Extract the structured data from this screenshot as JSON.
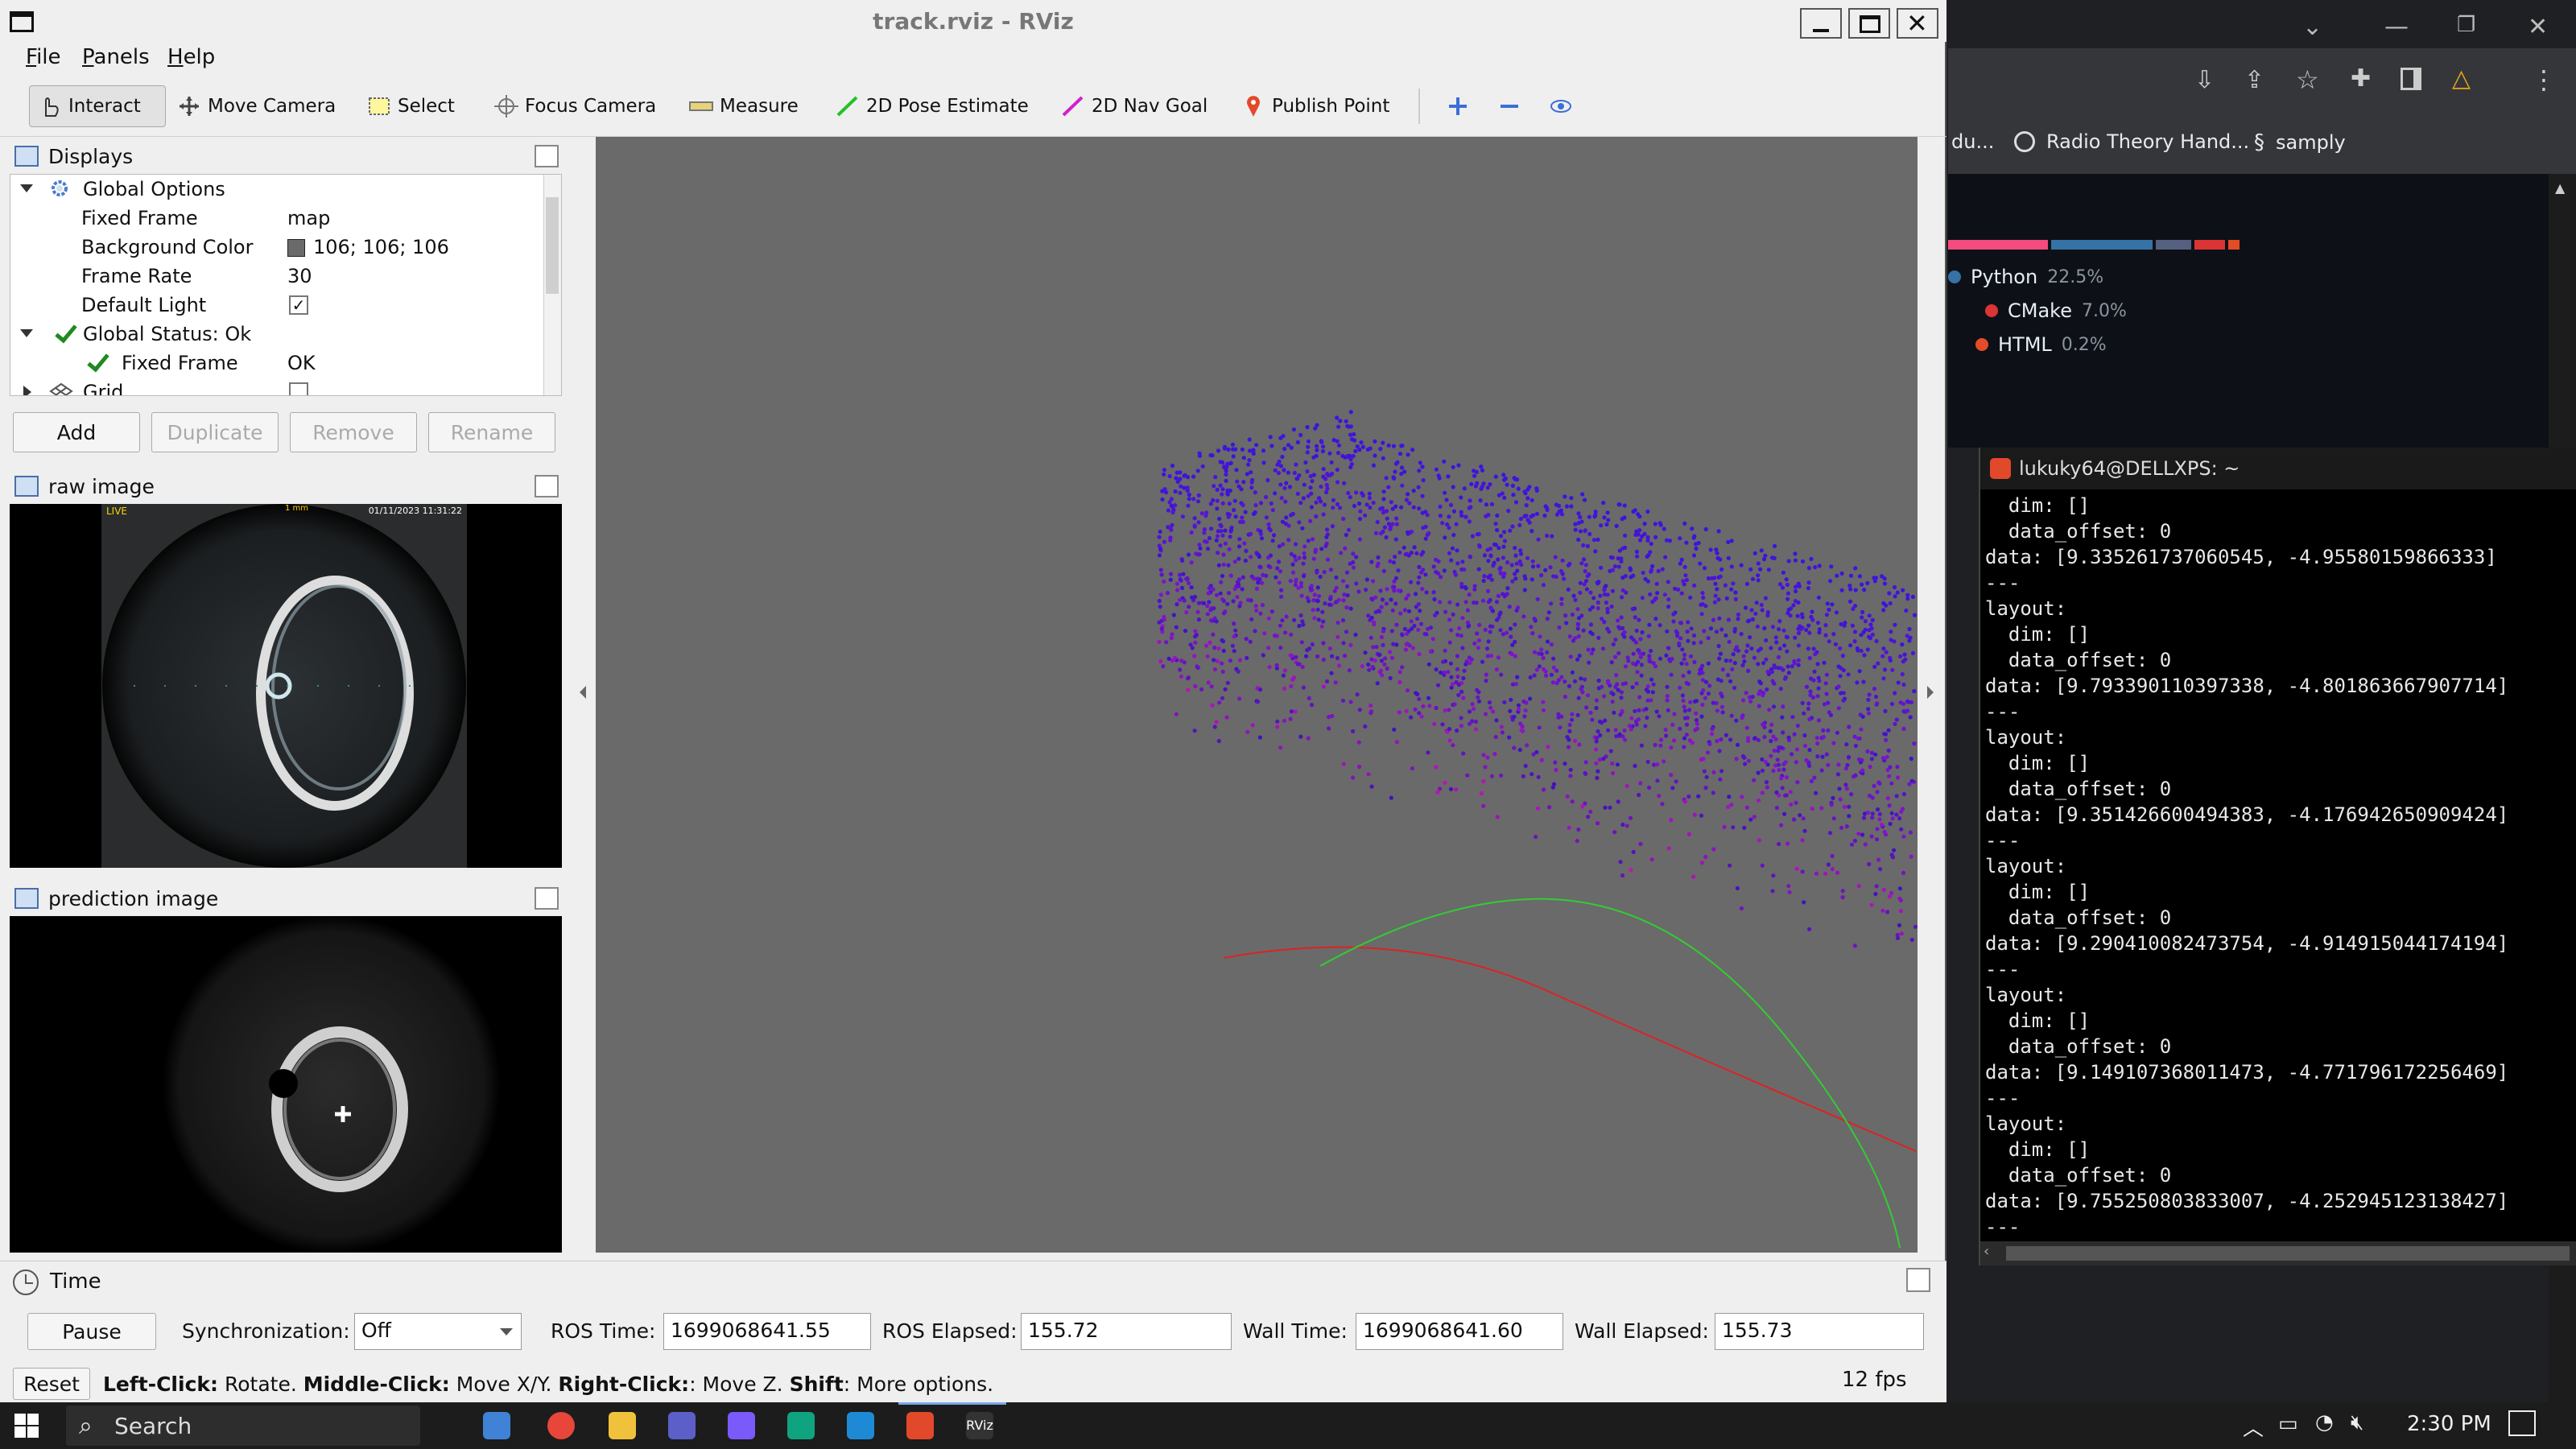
{
  "window": {
    "title": "track.rviz - RViz"
  },
  "menu": [
    "File",
    "Panels",
    "Help"
  ],
  "toolbar": {
    "interact": "Interact",
    "move_camera": "Move Camera",
    "select": "Select",
    "focus_camera": "Focus Camera",
    "measure": "Measure",
    "pose_estimate": "2D Pose Estimate",
    "nav_goal": "2D Nav Goal",
    "publish_point": "Publish Point"
  },
  "displays": {
    "title": "Displays",
    "rows": {
      "global_options": "Global Options",
      "fixed_frame": {
        "key": "Fixed Frame",
        "value": "map"
      },
      "background_color": {
        "key": "Background Color",
        "value": "106; 106; 106",
        "swatch": "#6a6a6a"
      },
      "frame_rate": {
        "key": "Frame Rate",
        "value": "30"
      },
      "default_light": {
        "key": "Default Light",
        "value": "✓"
      },
      "global_status": "Global Status: Ok",
      "status_fixed_frame": {
        "key": "Fixed Frame",
        "value": "OK"
      },
      "grid": "Grid"
    },
    "buttons": {
      "add": "Add",
      "duplicate": "Duplicate",
      "remove": "Remove",
      "rename": "Rename"
    }
  },
  "raw_image": {
    "title": "raw image",
    "overlay_left": "LIVE",
    "overlay_center": "1 mm",
    "overlay_right": "01/11/2023 11:31:22"
  },
  "prediction_image": {
    "title": "prediction image"
  },
  "time": {
    "title": "Time",
    "pause": "Pause",
    "sync_label": "Synchronization:",
    "sync_value": "Off",
    "ros_time_label": "ROS Time:",
    "ros_time": "1699068641.55",
    "ros_elapsed_label": "ROS Elapsed:",
    "ros_elapsed": "155.72",
    "wall_time_label": "Wall Time:",
    "wall_time": "1699068641.60",
    "wall_elapsed_label": "Wall Elapsed:",
    "wall_elapsed": "155.73",
    "reset": "Reset",
    "hint_left": "Left-Click:",
    "hint_left_t": " Rotate. ",
    "hint_middle": "Middle-Click:",
    "hint_middle_t": " Move X/Y. ",
    "hint_right": "Right-Click:",
    "hint_right_t": ": Move Z. ",
    "hint_shift": "Shift",
    "hint_shift_t": ": More options.",
    "fps": "12 fps"
  },
  "browser": {
    "bookmarks": [
      "du...",
      "Radio Theory Hand...",
      "samply"
    ],
    "languages": [
      {
        "name": "Python",
        "pct": "22.5%",
        "color": "#3572A5"
      },
      {
        "name": "CMake",
        "pct": "7.0%",
        "color": "#DA3434"
      },
      {
        "name": "HTML",
        "pct": "0.2%",
        "color": "#e34c26"
      }
    ]
  },
  "terminal": {
    "title": "lukuky64@DELLXPS: ~",
    "lines": [
      "  dim: []",
      "  data_offset: 0",
      "data: [9.335261737060545, -4.95580159866333]",
      "---",
      "layout:",
      "  dim: []",
      "  data_offset: 0",
      "data: [9.793390110397338, -4.801863667907714]",
      "---",
      "layout:",
      "  dim: []",
      "  data_offset: 0",
      "data: [9.351426600494383, -4.176942650909424]",
      "---",
      "layout:",
      "  dim: []",
      "  data_offset: 0",
      "data: [9.290410082473754, -4.914915044174194]",
      "---",
      "layout:",
      "  dim: []",
      "  data_offset: 0",
      "data: [9.149107368011473, -4.771796172256469]",
      "---",
      "layout:",
      "  dim: []",
      "  data_offset: 0",
      "data: [9.755250803833007, -4.252945123138427]",
      "---"
    ]
  },
  "taskbar": {
    "search": "Search",
    "clock": "2:30 PM"
  }
}
